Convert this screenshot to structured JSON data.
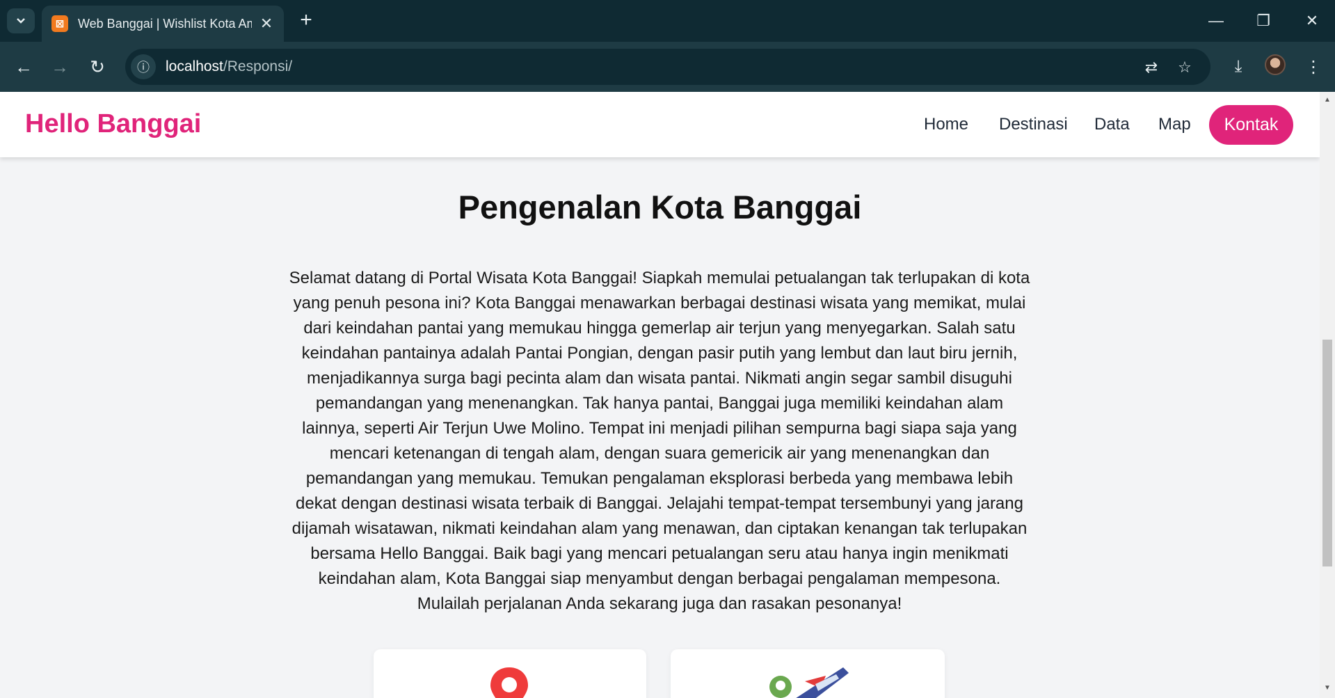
{
  "browser": {
    "tab_title": "Web Banggai | Wishlist Kota Am",
    "url_host": "localhost",
    "url_path": "/Responsi/"
  },
  "site": {
    "logo": "Hello Banggai",
    "nav": [
      "Home",
      "Destinasi",
      "Data",
      "Map"
    ],
    "cta": "Kontak",
    "accent_color": "#e0247a"
  },
  "main": {
    "title": "Pengenalan Kota Banggai",
    "intro": "Selamat datang di Portal Wisata Kota Banggai! Siapkah memulai petualangan tak terlupakan di kota yang penuh pesona ini? Kota Banggai menawarkan berbagai destinasi wisata yang memikat, mulai dari keindahan pantai yang memukau hingga gemerlap air terjun yang menyegarkan. Salah satu keindahan pantainya adalah Pantai Pongian, dengan pasir putih yang lembut dan laut biru jernih, menjadikannya surga bagi pecinta alam dan wisata pantai. Nikmati angin segar sambil disuguhi pemandangan yang menenangkan. Tak hanya pantai, Banggai juga memiliki keindahan alam lainnya, seperti Air Terjun Uwe Molino. Tempat ini menjadi pilihan sempurna bagi siapa saja yang mencari ketenangan di tengah alam, dengan suara gemericik air yang menenangkan dan pemandangan yang memukau. Temukan pengalaman eksplorasi berbeda yang membawa lebih dekat dengan destinasi wisata terbaik di Banggai. Jelajahi tempat-tempat tersembunyi yang jarang dijamah wisatawan, nikmati keindahan alam yang menawan, dan ciptakan kenangan tak terlupakan bersama Hello Banggai. Baik bagi yang mencari petualangan seru atau hanya ingin menikmati keindahan alam, Kota Banggai siap menyambut dengan berbagai pengalaman mempesona. Mulailah perjalanan Anda sekarang juga dan rasakan pesonanya!",
    "cards": [
      {
        "icon": "map-pin-icon"
      },
      {
        "icon": "travel-plane-icon"
      }
    ]
  }
}
